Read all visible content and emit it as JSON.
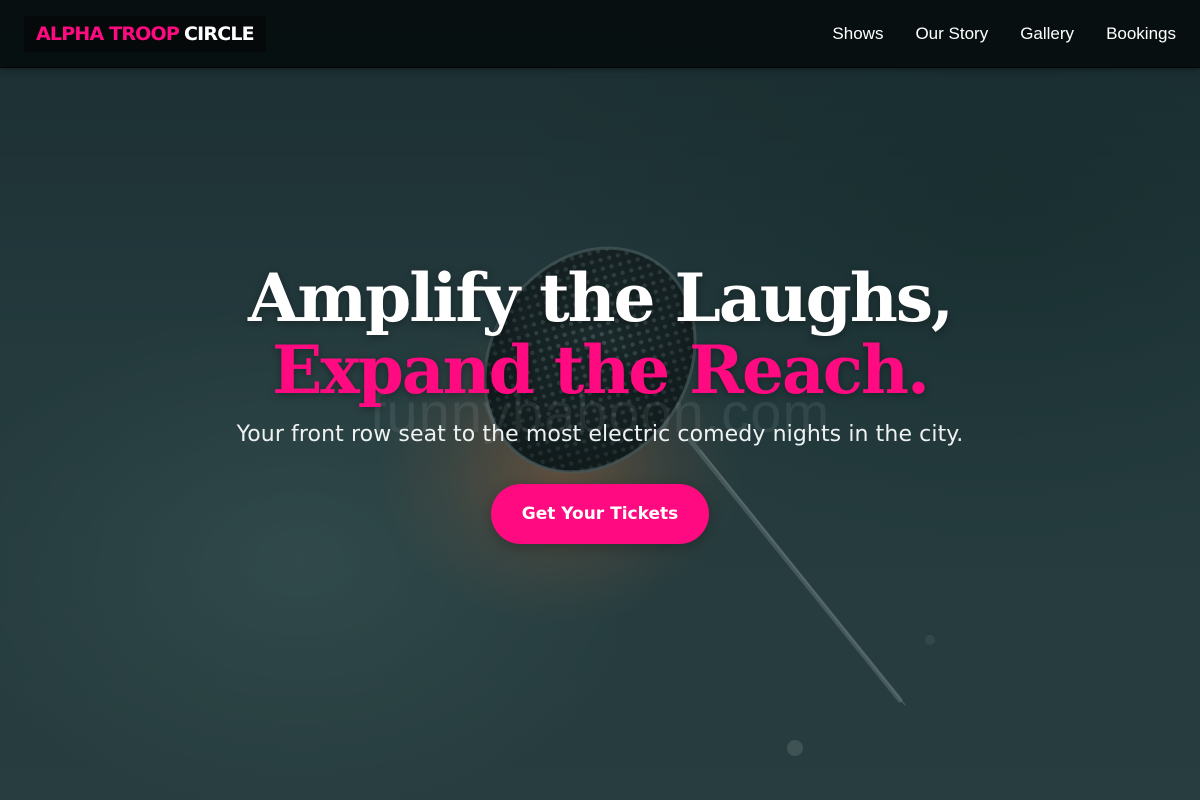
{
  "navbar": {
    "logo": {
      "accent": "ALPHA TROOP",
      "rest": "CIRCLE"
    },
    "links": [
      {
        "label": "Shows"
      },
      {
        "label": "Our Story"
      },
      {
        "label": "Gallery"
      },
      {
        "label": "Bookings"
      }
    ]
  },
  "hero": {
    "headline_line1": "Amplify the Laughs,",
    "headline_line2": "Expand the Reach.",
    "subtitle": "Your front row seat to the most electric comedy nights in the city.",
    "cta_label": "Get Your Tickets",
    "watermark": "funnybaboon.com",
    "background_subject": "microphone-image"
  },
  "colors": {
    "accent": "#ff0a80",
    "navbar_bg": "#060e0e",
    "hero_tint": "#2a3f42",
    "text_primary": "#ffffff"
  }
}
